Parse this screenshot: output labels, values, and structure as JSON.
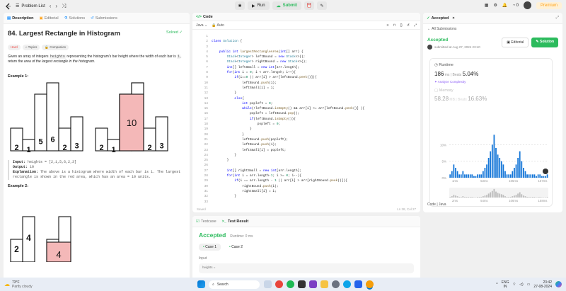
{
  "topbar": {
    "problem_list": "Problem List",
    "run": "Run",
    "submit": "Submit",
    "fire_count": "0",
    "premium": "Premium"
  },
  "left_tabs": {
    "description": "Description",
    "editorial": "Editorial",
    "solutions": "Solutions",
    "submissions": "Submissions"
  },
  "problem": {
    "title": "84. Largest Rectangle in Histogram",
    "solved": "Solved",
    "difficulty": "Hard",
    "topics": "Topics",
    "companies": "Companies",
    "desc_1": "Given an array of integers",
    "desc_code1": "heights",
    "desc_2": "representing the histogram's bar height where the width of each bar is",
    "desc_code2": "1",
    "desc_3": ", return",
    "desc_4": "the area of the largest rectangle in the histogram.",
    "example1_title": "Example 1:",
    "example1_bars": [
      2,
      1,
      5,
      6,
      2,
      3
    ],
    "example1_input_label": "Input:",
    "example1_input": "heights = [2,1,5,6,2,3]",
    "example1_output_label": "Output:",
    "example1_output": "10",
    "example1_expl_label": "Explanation:",
    "example1_expl": "The above is a histogram where width of each bar is 1. The largest rectangle is shown in the red area, which has an area = 10 units.",
    "example2_title": "Example 2:",
    "example2_bars": [
      2,
      4
    ],
    "highlight_value_1": "10",
    "highlight_value_2": "4"
  },
  "code_panel": {
    "title": "Code",
    "language": "Java",
    "mode": "Auto",
    "saved": "Saved",
    "cursor": "Ln 38, Col 27",
    "line_numbers": [
      "1",
      "2",
      "3",
      "4",
      "5",
      "6",
      "7",
      "8",
      "9",
      "10",
      "11",
      "12",
      "13",
      "14",
      "15",
      "16",
      "17",
      "18",
      "19",
      "20",
      "21",
      "22",
      "23",
      "24",
      "25",
      "26",
      "27",
      "28",
      "29",
      "30",
      "31",
      "32",
      "33"
    ]
  },
  "test_panel": {
    "testcase": "Testcase",
    "test_result": "Test Result",
    "accepted": "Accepted",
    "runtime": "Runtime: 0 ms",
    "case1": "Case 1",
    "case2": "Case 2",
    "input_label": "Input",
    "input_value": "heights ="
  },
  "right_panel": {
    "tab": "Accepted",
    "all_submissions": "All Submissions",
    "status": "Accepted",
    "submitted": "submitted at Aug 27, 2024 23:40",
    "editorial": "Editorial",
    "solution": "Solution",
    "runtime_label": "Runtime",
    "runtime_value": "186",
    "runtime_unit": "ms",
    "beats_label": "Beats",
    "runtime_beats": "5.04%",
    "analyze": "Analyze Complexity",
    "memory_label": "Memory",
    "memory_value": "58.28",
    "memory_unit": "MB",
    "memory_beats": "16.63%",
    "chart_y_ticks": [
      "10%",
      "5%",
      "0%"
    ],
    "chart_x_ticks": [
      "1ms",
      "53ms",
      "105ms",
      "157ms"
    ],
    "mini_x_ticks": [
      "2ms",
      "54ms",
      "106ms",
      "158ms"
    ],
    "code_lang": "Code | Java"
  },
  "chart_data": {
    "type": "bar",
    "title": "",
    "xlabel": "",
    "ylabel": "",
    "ylim": [
      0,
      15
    ],
    "x_ticks": [
      "1ms",
      "53ms",
      "105ms",
      "157ms"
    ],
    "y_ticks": [
      "0%",
      "5%",
      "10%"
    ],
    "values": [
      1,
      2,
      4,
      3,
      2,
      1,
      1,
      2,
      1,
      1,
      1,
      1,
      1,
      0.5,
      0.5,
      1,
      1,
      1,
      2,
      3,
      4,
      6,
      8,
      10,
      13,
      9,
      7,
      6,
      5,
      4,
      2,
      1,
      1,
      1,
      2,
      3,
      4,
      6,
      8,
      5,
      3,
      2,
      1,
      1,
      1,
      1,
      1,
      0.5,
      1,
      1,
      0.5,
      0.5,
      0.5,
      1
    ]
  },
  "taskbar": {
    "weather_temp": "73°F",
    "weather_desc": "Partly cloudy",
    "search": "Search",
    "lang": "ENG",
    "region": "IN",
    "time": "23:42",
    "date": "27-08-2024"
  },
  "colors": {
    "accent_green": "#2cbb5d",
    "hard_red": "#ef4743",
    "highlight_fill": "#f4b8b8",
    "chart_blue": "#1677d8"
  }
}
